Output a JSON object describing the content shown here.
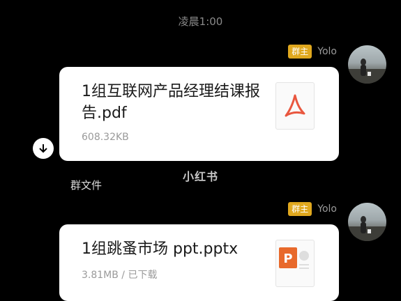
{
  "chat": {
    "timestamp": "凌晨1:00",
    "messages": [
      {
        "sender": {
          "name": "Yolo",
          "role_badge": "群主"
        },
        "file": {
          "name": "1组互联网产品经理结课报告.pdf",
          "meta": "608.32KB",
          "icon": "pdf-file-icon"
        },
        "source_label": "群文件"
      },
      {
        "sender": {
          "name": "Yolo",
          "role_badge": "群主"
        },
        "file": {
          "name": "1组跳蚤市场 ppt.pptx",
          "meta": "3.81MB / 已下载",
          "icon": "pptx-file-icon"
        }
      }
    ]
  },
  "watermark": "小红书",
  "colors": {
    "background": "#000000",
    "badge": "#e0a81e",
    "pdf_red": "#e9573f",
    "ppt_orange": "#e8692b"
  }
}
